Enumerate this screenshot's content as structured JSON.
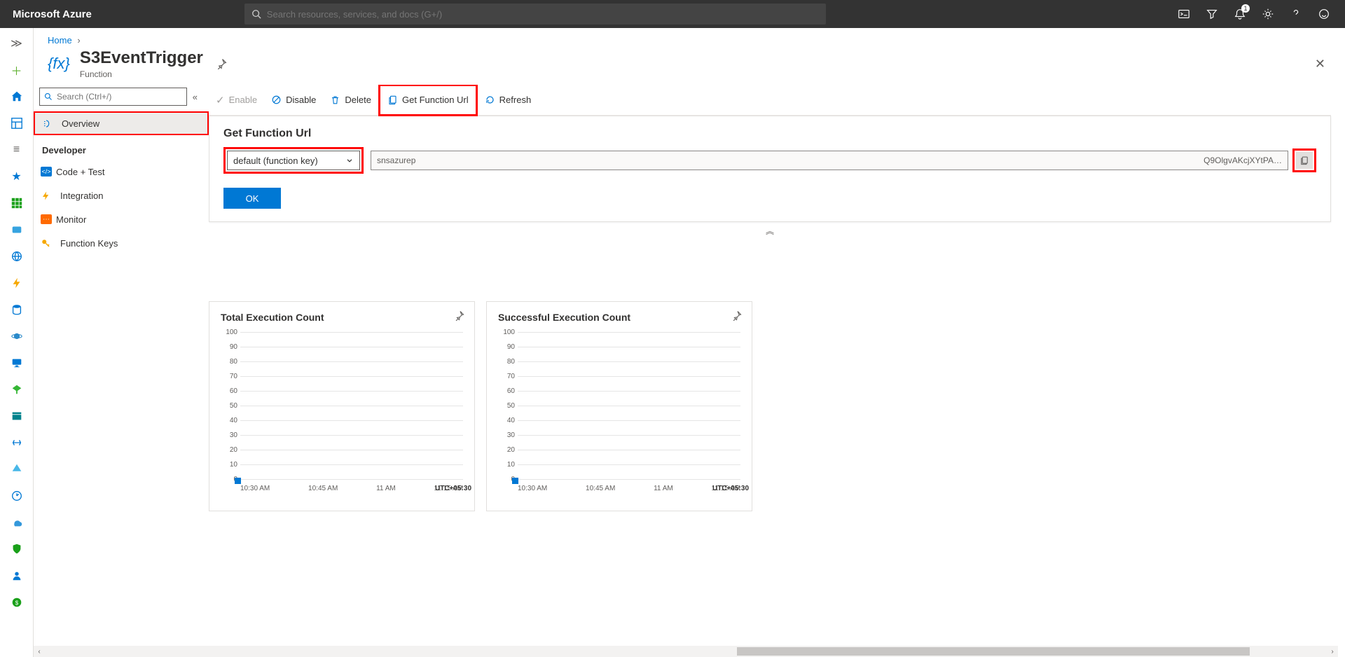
{
  "topbar": {
    "brand": "Microsoft Azure",
    "search_placeholder": "Search resources, services, and docs (G+/)",
    "notification_count": "1"
  },
  "breadcrumb": {
    "home": "Home"
  },
  "page": {
    "title": "S3EventTrigger",
    "subtitle": "Function",
    "icon_label": "{fx}"
  },
  "side_search": {
    "placeholder": "Search (Ctrl+/)"
  },
  "nav": {
    "overview": "Overview",
    "section": "Developer",
    "codetest": "Code + Test",
    "integration": "Integration",
    "monitor": "Monitor",
    "functionkeys": "Function Keys"
  },
  "cmdbar": {
    "enable": "Enable",
    "disable": "Disable",
    "delete": "Delete",
    "geturl": "Get Function Url",
    "refresh": "Refresh"
  },
  "panel": {
    "title": "Get Function Url",
    "key_selected": "default (function key)",
    "url_left": "snsazurep",
    "url_right": "Q9OlgvAKcjXYtPA…",
    "ok": "OK"
  },
  "charts": {
    "0": {
      "title": "Total Execution Count"
    },
    "1": {
      "title": "Successful Execution Count"
    },
    "timezone": "UTC+05:30"
  },
  "chart_data": [
    {
      "type": "line",
      "title": "Total Execution Count",
      "ylim": [
        0,
        100
      ],
      "y_ticks": [
        0,
        10,
        20,
        30,
        40,
        50,
        60,
        70,
        80,
        90,
        100
      ],
      "categories": [
        "10:30 AM",
        "10:45 AM",
        "11 AM",
        "11:15 AM"
      ],
      "series": [
        {
          "name": "Total Execution Count",
          "values": [
            0,
            0,
            0,
            0
          ]
        }
      ]
    },
    {
      "type": "line",
      "title": "Successful Execution Count",
      "ylim": [
        0,
        100
      ],
      "y_ticks": [
        0,
        10,
        20,
        30,
        40,
        50,
        60,
        70,
        80,
        90,
        100
      ],
      "categories": [
        "10:30 AM",
        "10:45 AM",
        "11 AM",
        "11:15 AM"
      ],
      "series": [
        {
          "name": "Successful Execution Count",
          "values": [
            0,
            0,
            0,
            0
          ]
        }
      ]
    }
  ]
}
